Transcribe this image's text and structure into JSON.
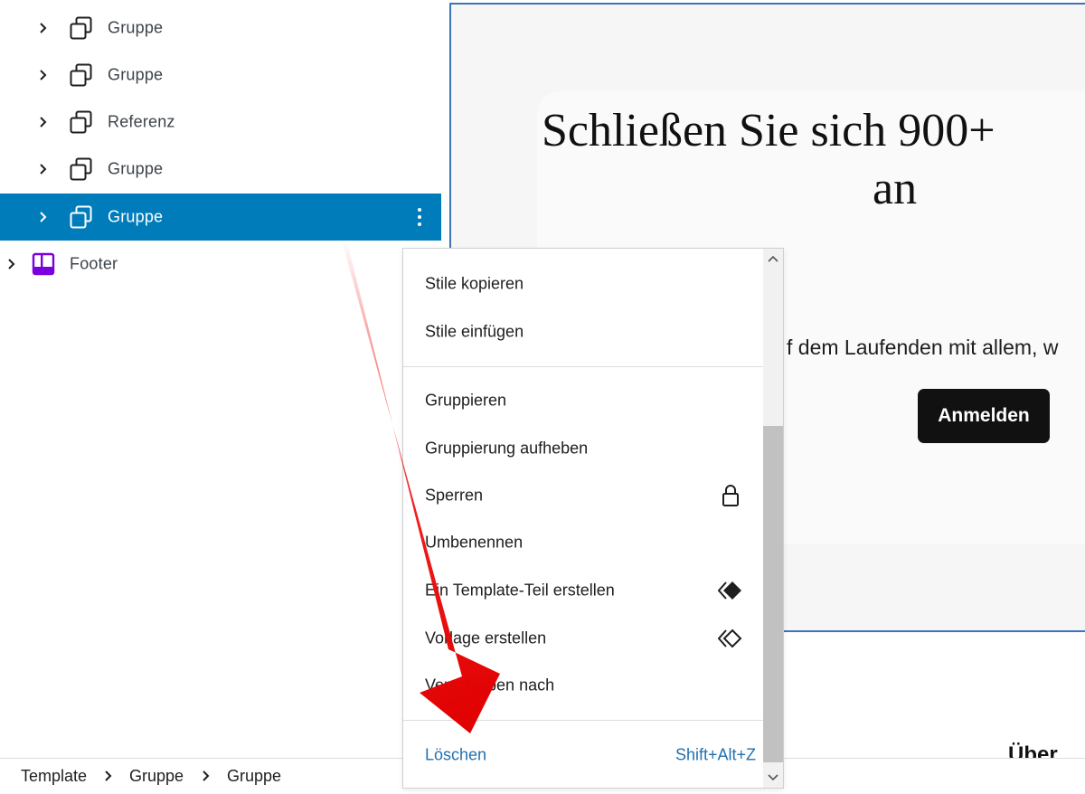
{
  "list_view": {
    "items": [
      {
        "label": "Gruppe",
        "icon": "group-block-icon"
      },
      {
        "label": "Gruppe",
        "icon": "group-block-icon"
      },
      {
        "label": "Referenz",
        "icon": "group-block-icon"
      },
      {
        "label": "Gruppe",
        "icon": "group-block-icon"
      },
      {
        "label": "Gruppe",
        "icon": "group-block-icon",
        "selected": true
      },
      {
        "label": "Footer",
        "icon": "template-part-footer-icon"
      }
    ]
  },
  "canvas": {
    "heading_line1": "Schließen Sie sich 900+",
    "heading_line2": "an",
    "subtext": "f dem Laufenden mit allem, w",
    "button_label": "Anmelden",
    "cut_text": "Über"
  },
  "context_menu": {
    "groups": [
      [
        {
          "label": "Stile kopieren"
        },
        {
          "label": "Stile einfügen"
        }
      ],
      [
        {
          "label": "Gruppieren"
        },
        {
          "label": "Gruppierung aufheben"
        },
        {
          "label": "Sperren",
          "icon": "lock-icon"
        },
        {
          "label": "Umbenennen"
        },
        {
          "label": "Ein Template-Teil erstellen",
          "icon": "symbol-filled-icon"
        },
        {
          "label": "Vorlage erstellen",
          "icon": "symbol-outline-icon"
        },
        {
          "label": "Verschieben nach"
        }
      ],
      [
        {
          "label": "Löschen",
          "shortcut": "Shift+Alt+Z"
        }
      ]
    ]
  },
  "breadcrumb": [
    "Template",
    "Gruppe",
    "Gruppe"
  ],
  "colors": {
    "selection": "#007cba",
    "link": "#2271b1",
    "annotation_arrow": "#ee1111",
    "footer_icon": "#7a00df"
  }
}
